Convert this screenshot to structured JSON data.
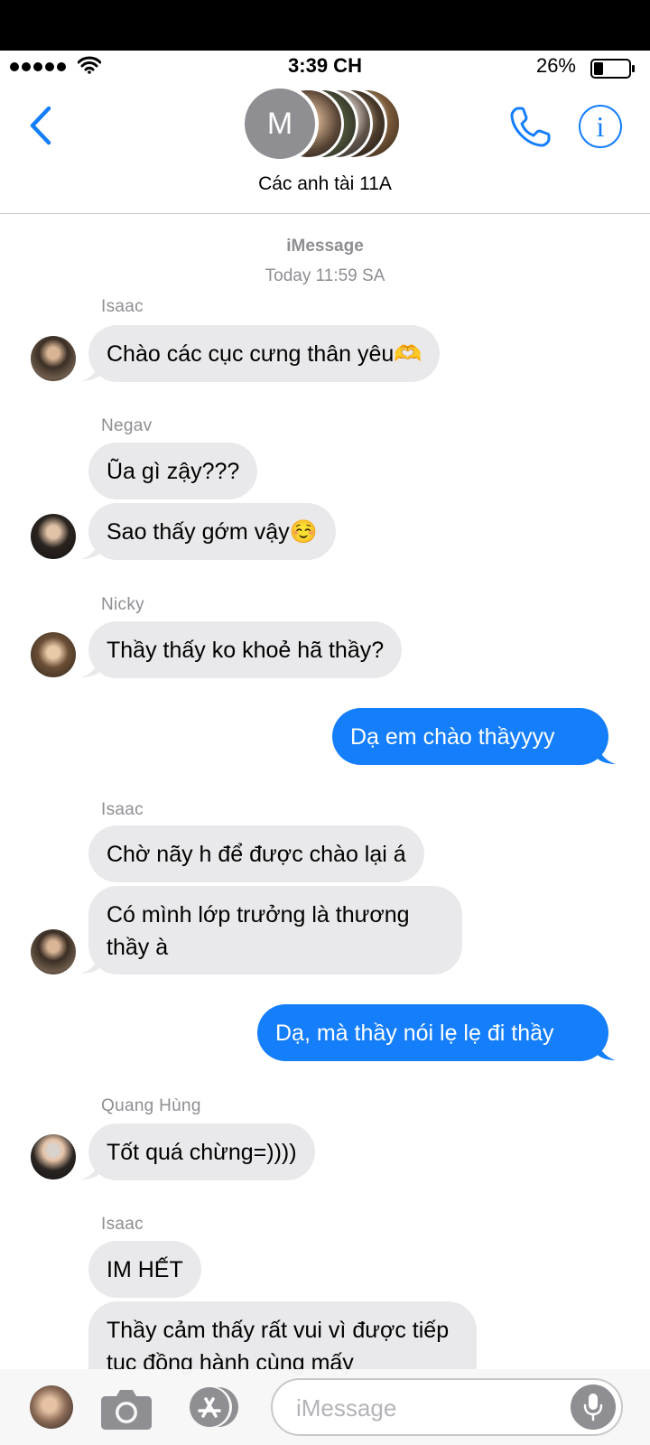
{
  "status_bar": {
    "time": "3:39 CH",
    "battery": "26%"
  },
  "header": {
    "avatar_initial": "M",
    "group_name": "Các anh tài 11A"
  },
  "thread": {
    "service": "iMessage",
    "timestamp": "Today 11:59 SA"
  },
  "messages": [
    {
      "sender": "Isaac",
      "texts": [
        "Chào các cục cưng thân yêu🫶"
      ]
    },
    {
      "sender": "Negav",
      "texts": [
        "Ũa gì zậy???",
        "Sao thấy gớm vậy☺️"
      ]
    },
    {
      "sender": "Nicky",
      "texts": [
        "Thầy thấy ko khoẻ hã thầy?"
      ]
    },
    {
      "sender": "me",
      "texts": [
        "Dạ em chào thầyyyy"
      ]
    },
    {
      "sender": "Isaac",
      "texts": [
        "Chờ nãy h để được chào lại á",
        "Có mình lớp trưởng là thương thầy à"
      ]
    },
    {
      "sender": "me",
      "texts": [
        "Dạ, mà thầy nói lẹ lẹ đi thầy"
      ]
    },
    {
      "sender": "Quang Hùng",
      "texts": [
        "Tốt quá chừng=))))"
      ]
    },
    {
      "sender": "Isaac",
      "texts": [
        "IM HẾT",
        "Thầy cảm thấy rất vui vì được tiếp tục đồng hành cùng mấy"
      ]
    }
  ],
  "composer": {
    "placeholder": "iMessage"
  },
  "colors": {
    "accent": "#147efb",
    "incoming_bubble": "#e9e9eb",
    "outgoing_bubble": "#147efb",
    "secondary_text": "#8e8e93"
  }
}
